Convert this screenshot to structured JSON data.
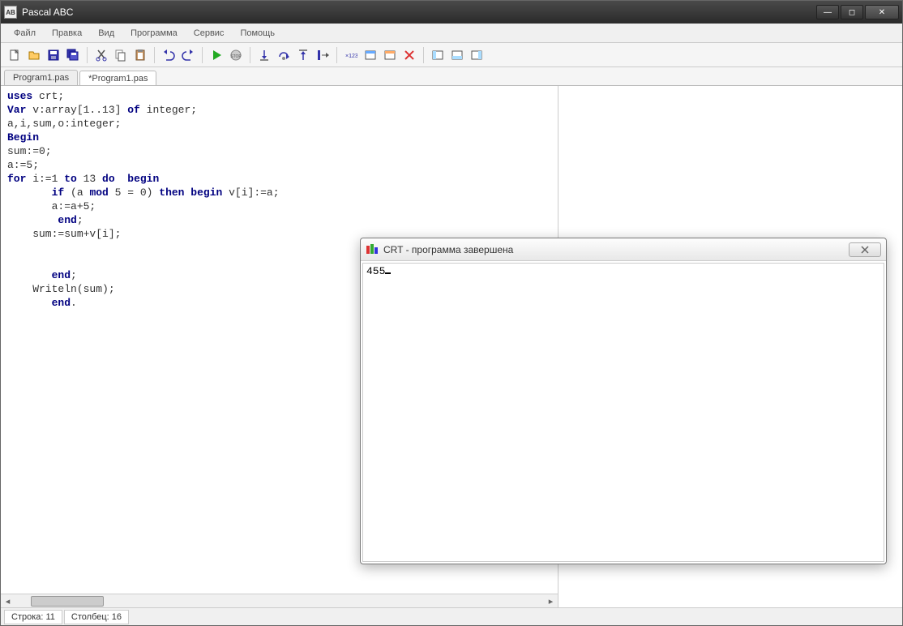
{
  "app": {
    "title": "Pascal ABC",
    "icon_label": "AB"
  },
  "menu": [
    "Файл",
    "Правка",
    "Вид",
    "Программа",
    "Сервис",
    "Помощь"
  ],
  "toolbar_icons": [
    "new-file-icon",
    "open-file-icon",
    "save-icon",
    "save-all-icon",
    "sep",
    "cut-icon",
    "copy-icon",
    "paste-icon",
    "sep",
    "undo-icon",
    "redo-icon",
    "sep",
    "run-icon",
    "stop-icon",
    "sep",
    "step-into-icon",
    "step-over-icon",
    "step-out-icon",
    "run-to-cursor-icon",
    "sep",
    "breakpoint-icon",
    "window1-icon",
    "window2-icon",
    "close-window-icon",
    "sep",
    "panel1-icon",
    "panel2-icon",
    "panel3-icon"
  ],
  "tabs": [
    {
      "label": "Program1.pas",
      "active": false
    },
    {
      "label": "*Program1.pas",
      "active": true
    }
  ],
  "code_lines": [
    {
      "t": "uses",
      "k": true,
      "rest": " crt;"
    },
    {
      "t": "Var",
      "k": true,
      "rest": " v:array[1..13] ",
      "t2": "of",
      "k2": true,
      "rest2": " integer;"
    },
    {
      "raw": "a,i,sum,o:integer;"
    },
    {
      "t": "Begin",
      "k": true,
      "rest": ""
    },
    {
      "raw": "sum:=0;"
    },
    {
      "raw": "a:=5;"
    },
    {
      "t": "for",
      "k": true,
      "rest": " i:=1 ",
      "t2": "to",
      "k2": true,
      "rest2": " 13 ",
      "t3": "do",
      "k3": true,
      "rest3": "  ",
      "t4": "begin",
      "k4": true,
      "rest4": ""
    },
    {
      "indent": "       ",
      "t": "if",
      "k": true,
      "rest": " (a ",
      "t2": "mod",
      "k2": true,
      "rest2": " 5 = 0) ",
      "t3": "then",
      "k3": true,
      "rest3": " ",
      "t4": "begin",
      "k4": true,
      "rest4": " v[i]:=a;"
    },
    {
      "raw": "       a:=a+5;"
    },
    {
      "indent": "        ",
      "t": "end",
      "k": true,
      "rest": ";"
    },
    {
      "raw": "    sum:=sum+v[i];"
    },
    {
      "raw": ""
    },
    {
      "raw": ""
    },
    {
      "indent": "       ",
      "t": "end",
      "k": true,
      "rest": ";"
    },
    {
      "raw": "    Writeln(sum);"
    },
    {
      "indent": "       ",
      "t": "end",
      "k": true,
      "rest": "."
    }
  ],
  "crt": {
    "title": "CRT - программа завершена",
    "output": "455"
  },
  "status": {
    "line_label": "Строка: 11",
    "col_label": "Столбец: 16"
  }
}
